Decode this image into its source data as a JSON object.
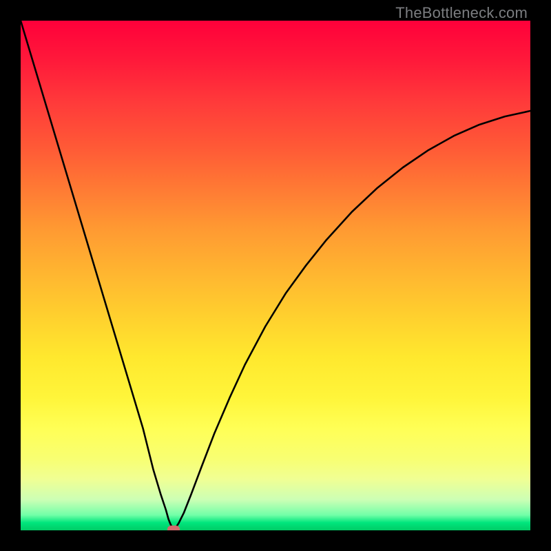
{
  "watermark": "TheBottleneck.com",
  "chart_data": {
    "type": "line",
    "title": "",
    "xlabel": "",
    "ylabel": "",
    "xlim": [
      0,
      100
    ],
    "ylim": [
      0,
      100
    ],
    "grid": false,
    "legend": false,
    "series": [
      {
        "name": "curve",
        "x": [
          0,
          3,
          6,
          9,
          12,
          15,
          18,
          21,
          24,
          26,
          27.5,
          28.5,
          29,
          29.4,
          29.8,
          30,
          30.4,
          31,
          32,
          33.5,
          35.5,
          38,
          41,
          44,
          48,
          52,
          56,
          60,
          65,
          70,
          75,
          80,
          85,
          90,
          95,
          100
        ],
        "y": [
          100,
          90,
          80,
          70,
          60,
          50,
          40,
          30,
          20,
          12,
          7,
          4,
          2.2,
          1.2,
          0.5,
          0.2,
          0.5,
          1.4,
          3.4,
          7.2,
          12.5,
          19,
          26,
          32.5,
          40,
          46.5,
          52,
          57,
          62.5,
          67.2,
          71.2,
          74.6,
          77.4,
          79.6,
          81.2,
          82.3
        ]
      }
    ],
    "marker": {
      "x": 30,
      "y": 0.2
    },
    "background_gradient": {
      "direction": "vertical",
      "stops": [
        {
          "pos": 0.0,
          "color": "#ff003a"
        },
        {
          "pos": 0.5,
          "color": "#ffb730"
        },
        {
          "pos": 0.8,
          "color": "#ffff56"
        },
        {
          "pos": 0.97,
          "color": "#72ffa8"
        },
        {
          "pos": 1.0,
          "color": "#00cc66"
        }
      ]
    }
  }
}
